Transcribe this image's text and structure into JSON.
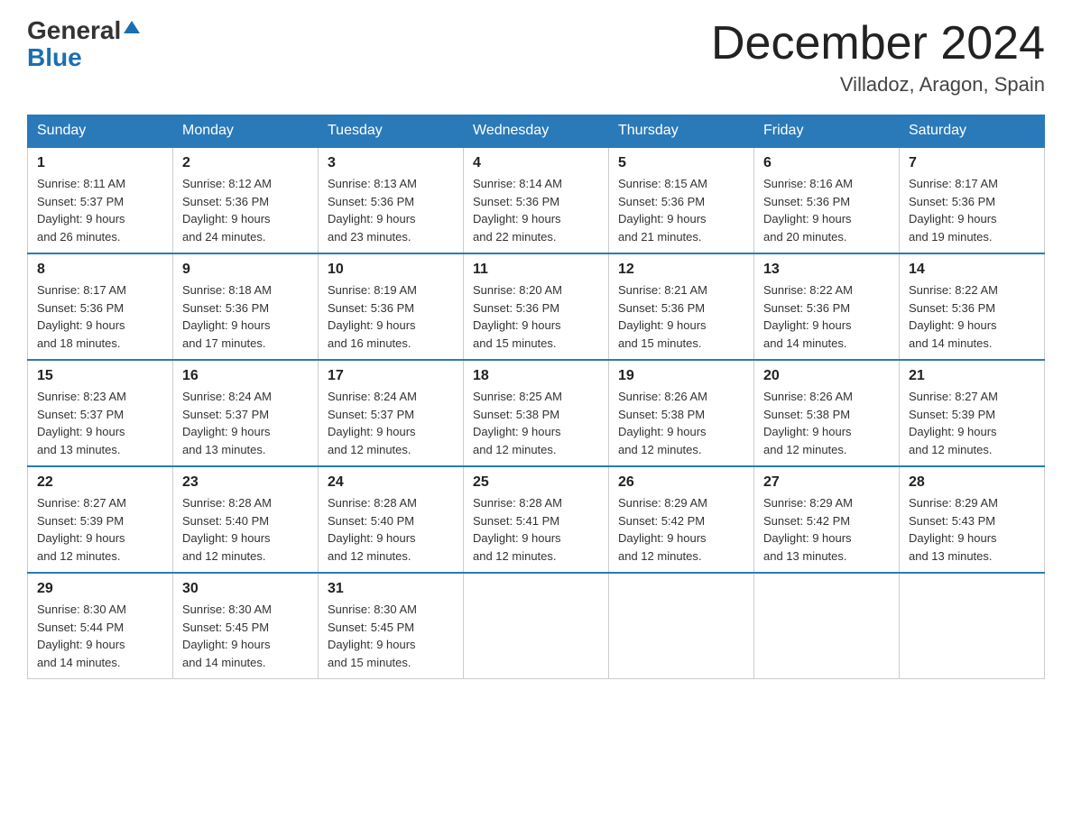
{
  "header": {
    "logo_line1": "General",
    "logo_line2": "Blue",
    "month_title": "December 2024",
    "location": "Villadoz, Aragon, Spain"
  },
  "days_of_week": [
    "Sunday",
    "Monday",
    "Tuesday",
    "Wednesday",
    "Thursday",
    "Friday",
    "Saturday"
  ],
  "weeks": [
    [
      {
        "day": "1",
        "sunrise": "8:11 AM",
        "sunset": "5:37 PM",
        "daylight": "9 hours and 26 minutes."
      },
      {
        "day": "2",
        "sunrise": "8:12 AM",
        "sunset": "5:36 PM",
        "daylight": "9 hours and 24 minutes."
      },
      {
        "day": "3",
        "sunrise": "8:13 AM",
        "sunset": "5:36 PM",
        "daylight": "9 hours and 23 minutes."
      },
      {
        "day": "4",
        "sunrise": "8:14 AM",
        "sunset": "5:36 PM",
        "daylight": "9 hours and 22 minutes."
      },
      {
        "day": "5",
        "sunrise": "8:15 AM",
        "sunset": "5:36 PM",
        "daylight": "9 hours and 21 minutes."
      },
      {
        "day": "6",
        "sunrise": "8:16 AM",
        "sunset": "5:36 PM",
        "daylight": "9 hours and 20 minutes."
      },
      {
        "day": "7",
        "sunrise": "8:17 AM",
        "sunset": "5:36 PM",
        "daylight": "9 hours and 19 minutes."
      }
    ],
    [
      {
        "day": "8",
        "sunrise": "8:17 AM",
        "sunset": "5:36 PM",
        "daylight": "9 hours and 18 minutes."
      },
      {
        "day": "9",
        "sunrise": "8:18 AM",
        "sunset": "5:36 PM",
        "daylight": "9 hours and 17 minutes."
      },
      {
        "day": "10",
        "sunrise": "8:19 AM",
        "sunset": "5:36 PM",
        "daylight": "9 hours and 16 minutes."
      },
      {
        "day": "11",
        "sunrise": "8:20 AM",
        "sunset": "5:36 PM",
        "daylight": "9 hours and 15 minutes."
      },
      {
        "day": "12",
        "sunrise": "8:21 AM",
        "sunset": "5:36 PM",
        "daylight": "9 hours and 15 minutes."
      },
      {
        "day": "13",
        "sunrise": "8:22 AM",
        "sunset": "5:36 PM",
        "daylight": "9 hours and 14 minutes."
      },
      {
        "day": "14",
        "sunrise": "8:22 AM",
        "sunset": "5:36 PM",
        "daylight": "9 hours and 14 minutes."
      }
    ],
    [
      {
        "day": "15",
        "sunrise": "8:23 AM",
        "sunset": "5:37 PM",
        "daylight": "9 hours and 13 minutes."
      },
      {
        "day": "16",
        "sunrise": "8:24 AM",
        "sunset": "5:37 PM",
        "daylight": "9 hours and 13 minutes."
      },
      {
        "day": "17",
        "sunrise": "8:24 AM",
        "sunset": "5:37 PM",
        "daylight": "9 hours and 12 minutes."
      },
      {
        "day": "18",
        "sunrise": "8:25 AM",
        "sunset": "5:38 PM",
        "daylight": "9 hours and 12 minutes."
      },
      {
        "day": "19",
        "sunrise": "8:26 AM",
        "sunset": "5:38 PM",
        "daylight": "9 hours and 12 minutes."
      },
      {
        "day": "20",
        "sunrise": "8:26 AM",
        "sunset": "5:38 PM",
        "daylight": "9 hours and 12 minutes."
      },
      {
        "day": "21",
        "sunrise": "8:27 AM",
        "sunset": "5:39 PM",
        "daylight": "9 hours and 12 minutes."
      }
    ],
    [
      {
        "day": "22",
        "sunrise": "8:27 AM",
        "sunset": "5:39 PM",
        "daylight": "9 hours and 12 minutes."
      },
      {
        "day": "23",
        "sunrise": "8:28 AM",
        "sunset": "5:40 PM",
        "daylight": "9 hours and 12 minutes."
      },
      {
        "day": "24",
        "sunrise": "8:28 AM",
        "sunset": "5:40 PM",
        "daylight": "9 hours and 12 minutes."
      },
      {
        "day": "25",
        "sunrise": "8:28 AM",
        "sunset": "5:41 PM",
        "daylight": "9 hours and 12 minutes."
      },
      {
        "day": "26",
        "sunrise": "8:29 AM",
        "sunset": "5:42 PM",
        "daylight": "9 hours and 12 minutes."
      },
      {
        "day": "27",
        "sunrise": "8:29 AM",
        "sunset": "5:42 PM",
        "daylight": "9 hours and 13 minutes."
      },
      {
        "day": "28",
        "sunrise": "8:29 AM",
        "sunset": "5:43 PM",
        "daylight": "9 hours and 13 minutes."
      }
    ],
    [
      {
        "day": "29",
        "sunrise": "8:30 AM",
        "sunset": "5:44 PM",
        "daylight": "9 hours and 14 minutes."
      },
      {
        "day": "30",
        "sunrise": "8:30 AM",
        "sunset": "5:45 PM",
        "daylight": "9 hours and 14 minutes."
      },
      {
        "day": "31",
        "sunrise": "8:30 AM",
        "sunset": "5:45 PM",
        "daylight": "9 hours and 15 minutes."
      },
      null,
      null,
      null,
      null
    ]
  ],
  "labels": {
    "sunrise_prefix": "Sunrise: ",
    "sunset_prefix": "Sunset: ",
    "daylight_prefix": "Daylight: "
  }
}
